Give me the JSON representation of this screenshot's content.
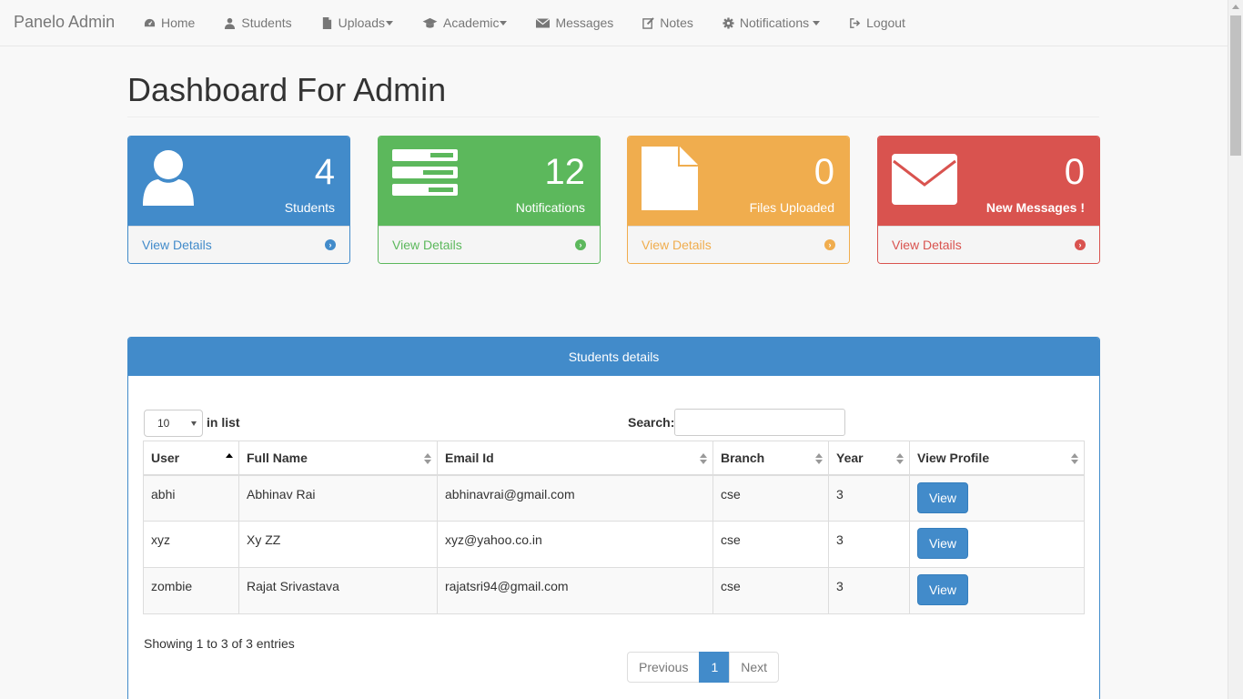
{
  "nav": {
    "brand": "Panelo Admin",
    "items": [
      {
        "label": "Home",
        "icon": "dashboard-icon"
      },
      {
        "label": "Students",
        "icon": "user-icon"
      },
      {
        "label": "Uploads",
        "icon": "file-icon"
      },
      {
        "label": "Academic",
        "icon": "graduation-cap-icon"
      },
      {
        "label": "Messages",
        "icon": "envelope-icon"
      },
      {
        "label": "Notes",
        "icon": "edit-icon"
      },
      {
        "label": "Notifications",
        "icon": "gear-icon"
      },
      {
        "label": "Logout",
        "icon": "sign-out-icon"
      }
    ]
  },
  "page": {
    "title": "Dashboard For Admin"
  },
  "panels": [
    {
      "number": "4",
      "label": "Students",
      "link": "View Details",
      "color": "#428bca",
      "icon": "user-icon"
    },
    {
      "number": "12",
      "label": "Notifications",
      "link": "View Details",
      "color": "#5cb85c",
      "icon": "tasks-icon"
    },
    {
      "number": "0",
      "label": "Files Uploaded",
      "link": "View Details",
      "color": "#f0ad4e",
      "icon": "file-icon"
    },
    {
      "number": "0",
      "label": "New Messages !",
      "link": "View Details",
      "color": "#d9534f",
      "icon": "envelope-icon"
    }
  ],
  "table_panel": {
    "title": "Students details",
    "length_value": "10",
    "length_label": "in list",
    "search_label": "Search:",
    "columns": [
      "User",
      "Full Name",
      "Email Id",
      "Branch",
      "Year",
      "View Profile"
    ],
    "rows": [
      {
        "user": "abhi",
        "full_name": "Abhinav Rai",
        "email": "abhinavrai@gmail.com",
        "branch": "cse",
        "year": "3",
        "action": "View"
      },
      {
        "user": "xyz",
        "full_name": "Xy ZZ",
        "email": "xyz@yahoo.co.in",
        "branch": "cse",
        "year": "3",
        "action": "View"
      },
      {
        "user": "zombie",
        "full_name": "Rajat Srivastava",
        "email": "rajatsri94@gmail.com",
        "branch": "cse",
        "year": "3",
        "action": "View"
      }
    ],
    "info": "Showing 1 to 3 of 3 entries",
    "pagination": {
      "previous": "Previous",
      "page": "1",
      "next": "Next"
    }
  }
}
